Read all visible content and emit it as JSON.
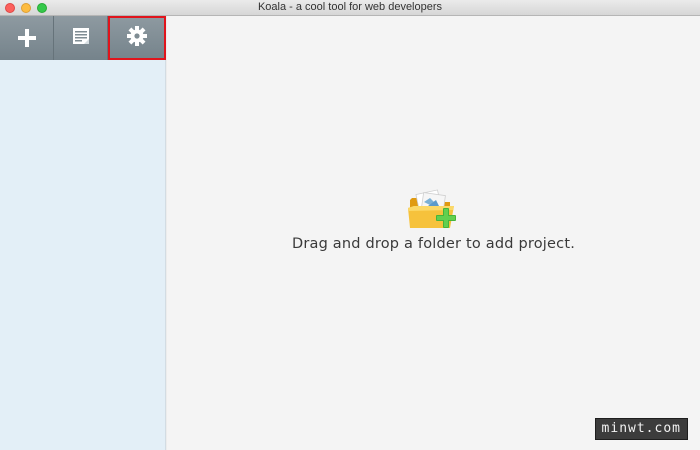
{
  "window": {
    "title": "Koala - a cool tool for web developers"
  },
  "toolbar": {
    "buttons": [
      {
        "name": "add-project",
        "icon": "plus-icon"
      },
      {
        "name": "log",
        "icon": "log-icon"
      },
      {
        "name": "settings",
        "icon": "gear-icon",
        "selected": true
      }
    ],
    "selected_outline_color": "#e0141c"
  },
  "main": {
    "empty_icon": "folder-add-icon",
    "message": "Drag and drop a folder to add project."
  },
  "watermark": {
    "text": "minwt.com"
  },
  "colors": {
    "sidebar_bg": "#e3eff7",
    "main_bg": "#f4f4f4",
    "toolbar_bg": "#7f8c93"
  }
}
